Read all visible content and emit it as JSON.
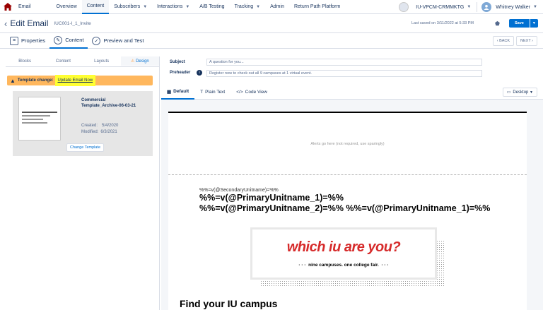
{
  "nav": {
    "app": "Email",
    "items": [
      {
        "label": "Overview",
        "caret": false
      },
      {
        "label": "Content",
        "caret": false,
        "active": true
      },
      {
        "label": "Subscribers",
        "caret": true
      },
      {
        "label": "Interactions",
        "caret": true
      },
      {
        "label": "A/B Testing",
        "caret": false
      },
      {
        "label": "Tracking",
        "caret": true
      },
      {
        "label": "Admin",
        "caret": false
      },
      {
        "label": "Return Path Platform",
        "caret": false
      }
    ],
    "account": "IU-VPCM-CRMMKTG",
    "user": "Whitney Walker"
  },
  "header": {
    "title": "Edit Email",
    "email_name": "IUC001-I_1_Invite",
    "last_saved": "Last saved on 3/11/2022 at 5:33 PM",
    "save_label": "Save"
  },
  "tabs": {
    "properties": "Properties",
    "content": "Content",
    "preview": "Preview and Test",
    "back": "BACK",
    "next": "NEXT"
  },
  "left_panel": {
    "tabs": [
      "Blocks",
      "Content",
      "Layouts",
      "Design"
    ],
    "warning_label": "Template change:",
    "warning_link": "Update Email Now",
    "template_name": "Commercial Template_Archive-06-03-21",
    "created_label": "Created:",
    "created": "5/4/2020",
    "modified_label": "Modified:",
    "modified": "6/3/2021",
    "change_template": "Change Template"
  },
  "fields": {
    "subject_label": "Subject",
    "subject": "A question for you...",
    "preheader_label": "Preheader",
    "preheader": "Register now to check out all 9 campuses at 1 virtual event."
  },
  "content_tabs": {
    "default": "Default",
    "plain": "Plain Text",
    "code": "Code View",
    "device": "Desktop"
  },
  "email": {
    "alert": "Alerts go here (not required, use sparingly)",
    "secondary_unit": "%%=v(@SecondaryUnitname)=%%",
    "primary1": "%%=v(@PrimaryUnitname_1)=%%",
    "primary2": "%%=v(@PrimaryUnitname_2)=%% %%=v(@PrimaryUnitname_1)=%%",
    "banner_title": "which iu are you?",
    "banner_sub": "nine campuses. one college fair.",
    "heading": "Find your IU campus"
  },
  "colors": {
    "accent": "#0070d2",
    "warning": "#ffb75d",
    "highlight": "#ffff33",
    "brand_red": "#990000",
    "banner_red": "#d62a2a"
  }
}
